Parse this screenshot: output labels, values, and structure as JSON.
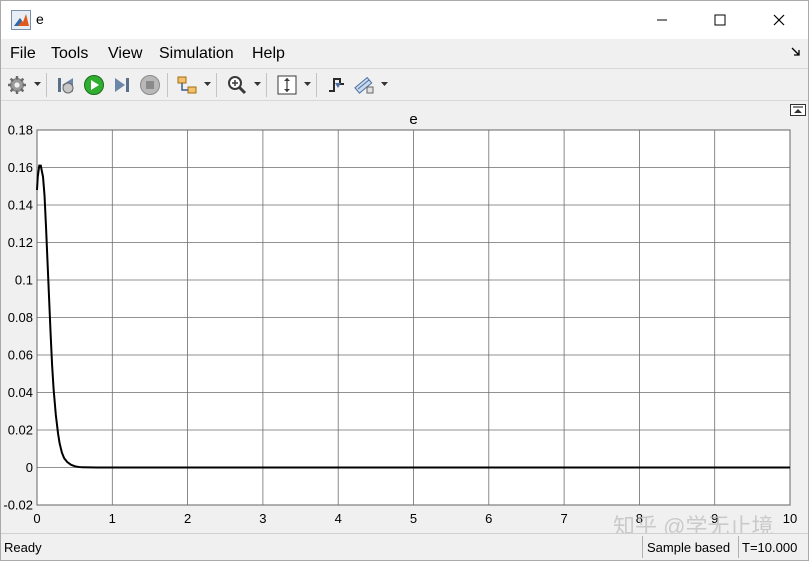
{
  "window": {
    "title": "e"
  },
  "menu": [
    "File",
    "Tools",
    "View",
    "Simulation",
    "Help"
  ],
  "toolbar_icons": [
    "gear-icon",
    "step-back-icon",
    "run-icon",
    "step-forward-icon",
    "stop-icon",
    "highlight-icon",
    "zoom-icon",
    "fit-icon",
    "triggers-icon",
    "cursor-measure-icon"
  ],
  "status": {
    "left": "Ready",
    "sample": "Sample based",
    "time": "T=10.000"
  },
  "watermark": "知乎 @学无止境",
  "colors": {
    "trace": "#000000",
    "grid": "#6e6e6e",
    "axes_bg": "#ffffff",
    "run_green": "#1f9d1f"
  },
  "chart_data": {
    "type": "line",
    "title": "e",
    "xlabel": "",
    "ylabel": "",
    "xlim": [
      0,
      10
    ],
    "ylim": [
      -0.02,
      0.18
    ],
    "xticks": [
      0,
      1,
      2,
      3,
      4,
      5,
      6,
      7,
      8,
      9,
      10
    ],
    "xtick_labels": [
      "0",
      "1",
      "2",
      "3",
      "4",
      "5",
      "6",
      "7",
      "8",
      "9",
      "10"
    ],
    "yticks": [
      -0.02,
      0,
      0.02,
      0.04,
      0.06,
      0.08,
      0.1,
      0.12,
      0.14,
      0.16,
      0.18
    ],
    "ytick_labels": [
      "-0.02",
      "0",
      "0.02",
      "0.04",
      "0.06",
      "0.08",
      "0.1",
      "0.12",
      "0.14",
      "0.16",
      "0.18"
    ],
    "grid": true,
    "series": [
      {
        "x": [
          0,
          0.01,
          0.03,
          0.05,
          0.08,
          0.1,
          0.12,
          0.15,
          0.18,
          0.2,
          0.22,
          0.25,
          0.28,
          0.3,
          0.33,
          0.36,
          0.4,
          0.45,
          0.5,
          0.55,
          0.6,
          0.7,
          0.8,
          1.0,
          2.0,
          3.0,
          4.0,
          5.0,
          6.0,
          7.0,
          8.0,
          9.0,
          10.0
        ],
        "y": [
          0.148,
          0.155,
          0.161,
          0.161,
          0.155,
          0.145,
          0.128,
          0.1,
          0.072,
          0.055,
          0.042,
          0.028,
          0.018,
          0.013,
          0.008,
          0.005,
          0.003,
          0.0015,
          0.0007,
          0.0003,
          0.0001,
          5e-05,
          0,
          0,
          0,
          0,
          0,
          0,
          0,
          0,
          0,
          0,
          0
        ]
      }
    ]
  }
}
